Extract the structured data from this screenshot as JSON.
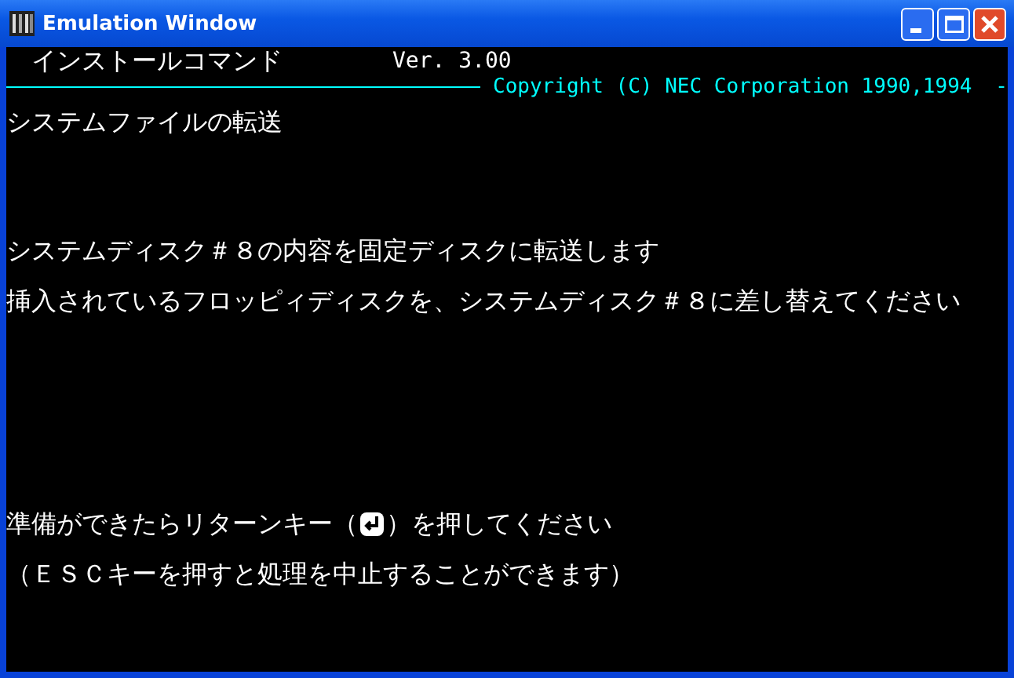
{
  "window": {
    "title": "Emulation Window"
  },
  "header": {
    "command": "インストールコマンド",
    "version": "Ver. 3.00",
    "copyright": "Copyright (C) NEC Corporation 1990,1994",
    "trail": "-"
  },
  "screen_title": "システムファイルの転送",
  "messages": [
    "システムディスク＃８の内容を固定ディスクに転送します",
    "挿入されているフロッピィディスクを、システムディスク＃８に差し替えてください"
  ],
  "prompt": {
    "before": "準備ができたらリターンキー（",
    "after": "）を押してください"
  },
  "note": "（ＥＳＣキーを押すと処理を中止することができます）"
}
